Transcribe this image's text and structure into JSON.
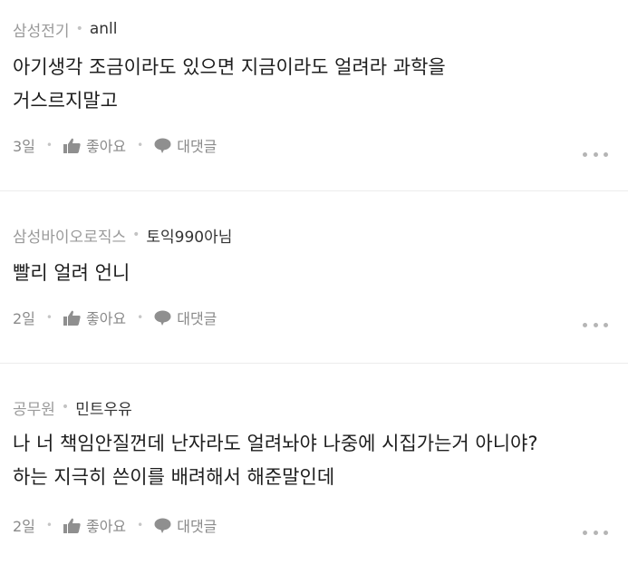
{
  "comments": [
    {
      "company": "삼성전기",
      "nickname": "anll",
      "text": "아기생각 조금이라도 있으면 지금이라도 얼려라 과학을\n거스르지말고",
      "time": "3일",
      "like_label": "좋아요",
      "reply_label": "대댓글"
    },
    {
      "company": "삼성바이오로직스",
      "nickname": "토익990아님",
      "text": "빨리 얼려 언니",
      "time": "2일",
      "like_label": "좋아요",
      "reply_label": "대댓글"
    },
    {
      "company": "공무원",
      "nickname": "민트우유",
      "text": "나 너 책임안질껀데 난자라도 얼려놔야 나중에 시집가는거 아니야?\n하는 지극히 쓴이를 배려해서 해준말인데",
      "time": "2일",
      "like_label": "좋아요",
      "reply_label": "대댓글"
    }
  ],
  "icons": {
    "like": "thumbs-up-icon",
    "reply": "speech-bubble-icon",
    "more": "more-dots-icon"
  },
  "colors": {
    "company": "#9a9a9a",
    "nickname": "#333333",
    "body": "#1e1e1e",
    "meta": "#8a8a8a",
    "divider": "#ececec"
  }
}
